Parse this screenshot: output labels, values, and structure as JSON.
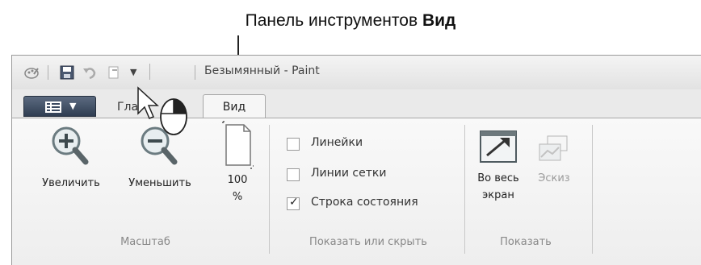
{
  "caption": {
    "prefix": "Панель инструментов ",
    "bold": "Вид"
  },
  "window": {
    "title": "Безымянный - Paint"
  },
  "quick_access": [
    {
      "name": "paint-logo-icon"
    },
    {
      "name": "save-icon"
    },
    {
      "name": "undo-icon"
    },
    {
      "name": "redo-icon"
    },
    {
      "name": "customize-dropdown-icon"
    }
  ],
  "tabs": {
    "main": "Главная",
    "main_visible": "Гла",
    "view": "Вид"
  },
  "ribbon": {
    "zoom_group": {
      "label": "Масштаб",
      "zoom_in": "Увеличить",
      "zoom_out": "Уменьшить",
      "zoom_100_line1": "100",
      "zoom_100_line2": "%"
    },
    "show_hide_group": {
      "label": "Показать или скрыть",
      "rulers": {
        "label": "Линейки",
        "checked": false
      },
      "gridlines": {
        "label": "Линии сетки",
        "checked": false
      },
      "statusbar": {
        "label": "Строка состояния",
        "checked": true
      }
    },
    "display_group": {
      "label": "Показать",
      "fullscreen_line1": "Во весь",
      "fullscreen_line2": "экран",
      "thumbnail": "Эскиз"
    }
  },
  "colors": {
    "ribbon_bg": "#f3f3f3",
    "app_button": "#3a4960",
    "disabled_text": "#9a9a9a"
  }
}
